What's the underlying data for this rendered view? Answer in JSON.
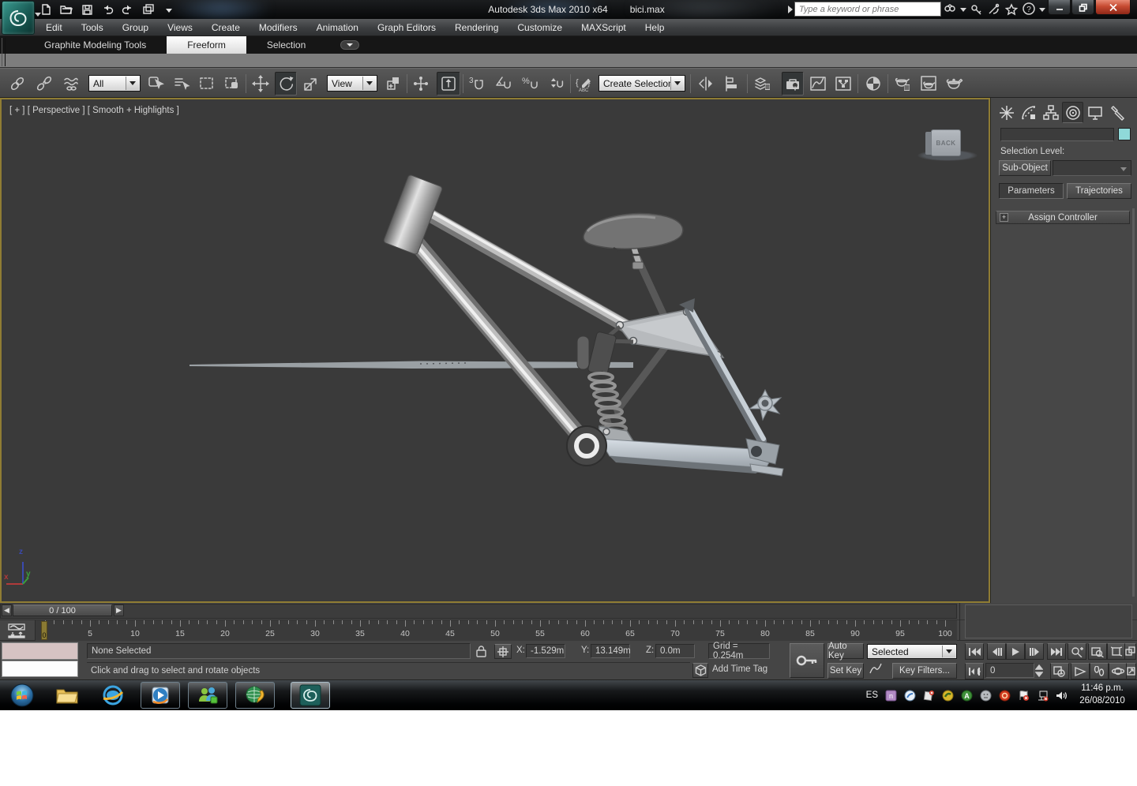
{
  "colors": {
    "viewport_border": "#8f7c33",
    "selection_color_swatch": "#8fd9d9",
    "close_button": "#c64a31",
    "time_marker": "#8a7a33"
  },
  "titlebar": {
    "app_title": "Autodesk 3ds Max  2010 x64",
    "doc_name": "bici.max",
    "search_placeholder": "Type a keyword or phrase"
  },
  "menus": [
    "Edit",
    "Tools",
    "Group",
    "Views",
    "Create",
    "Modifiers",
    "Animation",
    "Graph Editors",
    "Rendering",
    "Customize",
    "MAXScript",
    "Help"
  ],
  "ribbon": {
    "tab1": "Graphite Modeling Tools",
    "tab2": "Freeform",
    "tab3": "Selection"
  },
  "toolbar": {
    "filter": "All",
    "coords": "View",
    "selection_set": "Create Selection Se"
  },
  "viewport": {
    "label": "[ + ] [ Perspective ] [ Smooth + Highlights ]",
    "viewcube_face": "BACK",
    "axis_x": "x",
    "axis_y": "y",
    "axis_z": "z"
  },
  "timeline": {
    "slider": "0 / 100",
    "current": "0",
    "start": 0,
    "end": 100,
    "label_step": 5
  },
  "status": {
    "selection": "None Selected",
    "prompt": "Click and drag to select and rotate objects",
    "x_label": "X:",
    "x_val": "-1.529m",
    "y_label": "Y:",
    "y_val": "13.149m",
    "z_label": "Z:",
    "z_val": "0.0m",
    "grid": "Grid = 0.254m",
    "add_time_tag": "Add Time Tag"
  },
  "animation": {
    "auto_key": "Auto Key",
    "set_key": "Set Key",
    "key_filters": "Key Filters...",
    "mode": "Selected",
    "frame": "0"
  },
  "command_panel": {
    "selection_level": "Selection Level:",
    "sub_object": "Sub-Object",
    "parameters": "Parameters",
    "trajectories": "Trajectories",
    "assign_controller": "Assign Controller"
  },
  "taskbar": {
    "language": "ES",
    "clock_time": "11:46 p.m.",
    "clock_date": "26/08/2010"
  }
}
